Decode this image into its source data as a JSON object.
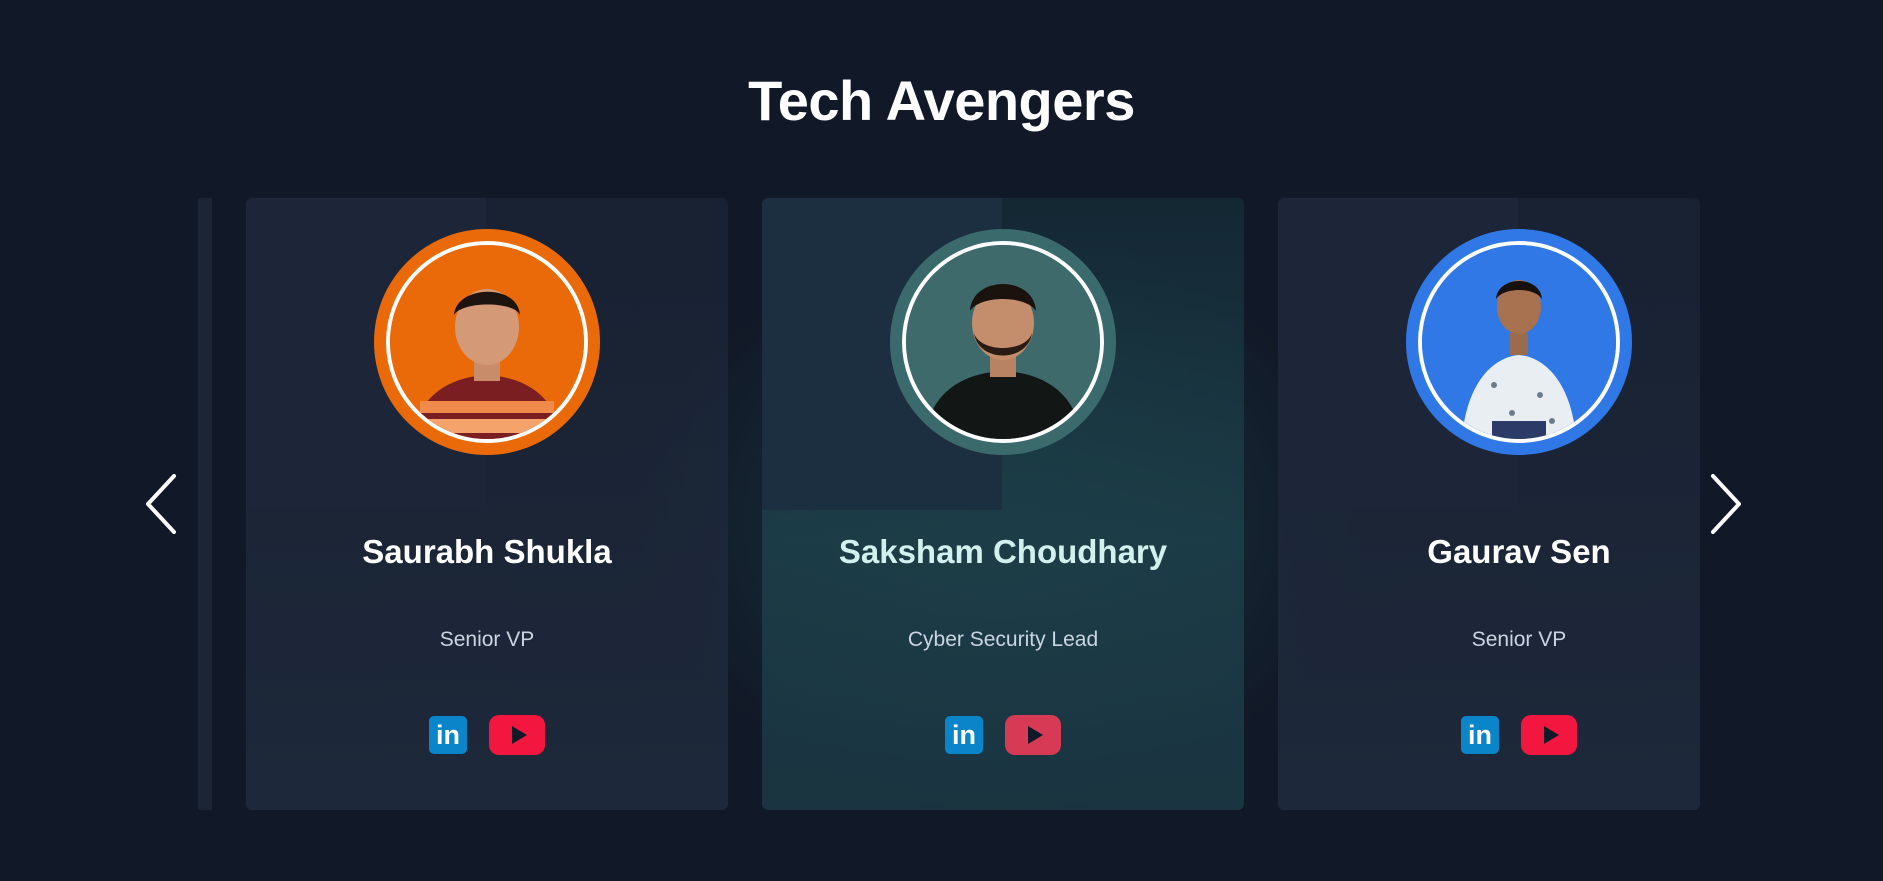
{
  "section": {
    "title": "Tech Avengers"
  },
  "carousel": {
    "prev_icon": "chevron-left-icon",
    "next_icon": "chevron-right-icon",
    "cards": [
      {
        "name": "Saurabh Shukla",
        "role": "Senior VP",
        "ring_color": "#ea6a0a",
        "photo_bg": "#ea6a0a",
        "linkedin_label": "in",
        "youtube_icon": "youtube-icon"
      },
      {
        "name": "Saksham Choudhary",
        "role": "Cyber Security Lead",
        "ring_color": "#3b6a6d",
        "photo_bg": "#3e6a6c",
        "linkedin_label": "in",
        "youtube_icon": "youtube-icon"
      },
      {
        "name": "Gaurav Sen",
        "role": "Senior VP",
        "ring_color": "#2f78e6",
        "photo_bg": "#2f78e6",
        "linkedin_label": "in",
        "youtube_icon": "youtube-icon"
      }
    ]
  },
  "colors": {
    "background": "#111827",
    "linkedin": "#0a85c9",
    "youtube": "#f3163f",
    "active_name": "#d2f1ee"
  }
}
